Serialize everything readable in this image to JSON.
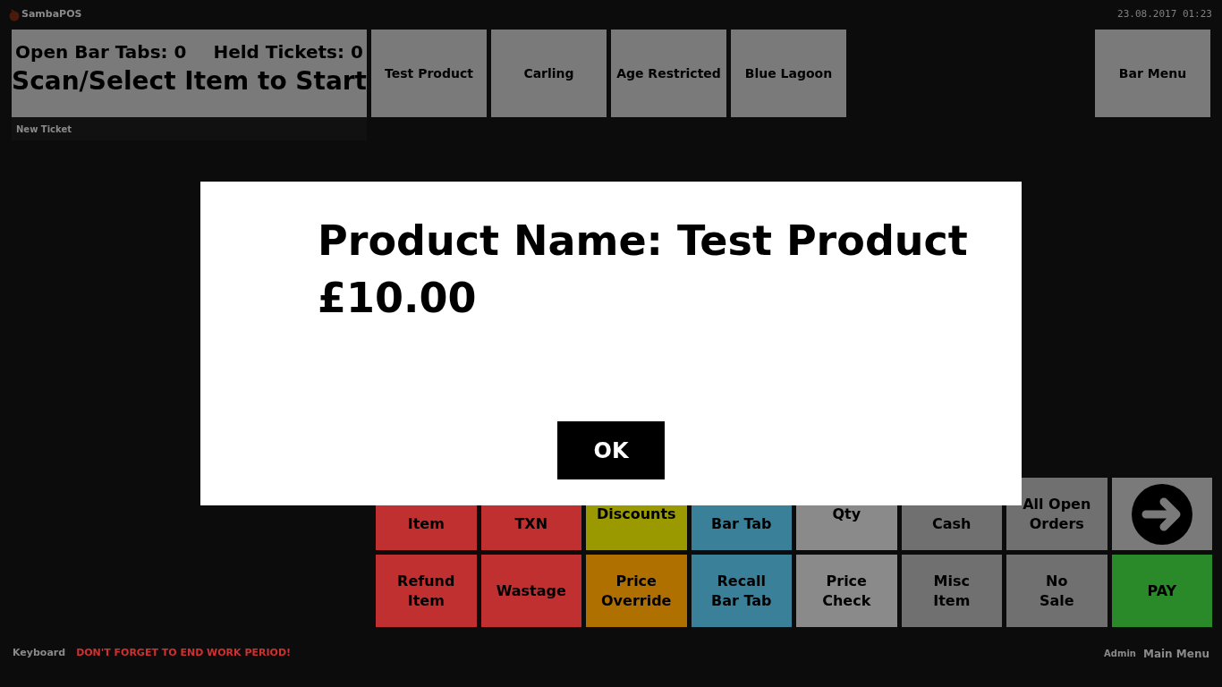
{
  "header": {
    "app_name": "SambaPOS",
    "datetime": "23.08.2017 01:23"
  },
  "ticket_panel": {
    "open_bar_tabs": "Open Bar Tabs: 0",
    "held_tickets": "Held Tickets: 0",
    "prompt": "Scan/Select Item to Start",
    "new_ticket": "New Ticket"
  },
  "products": [
    "Test Product",
    "Carling",
    "Age Restricted",
    "Blue Lagoon"
  ],
  "menu_button": "Bar Menu",
  "actions": [
    {
      "kind": "covered",
      "label": "Item",
      "color": "#c03030"
    },
    {
      "kind": "covered",
      "label": "TXN",
      "color": "#c03030"
    },
    {
      "kind": "text",
      "label": "Discounts",
      "color": "#9a9a00"
    },
    {
      "kind": "covered",
      "label": "Bar Tab",
      "color": "#3a8098"
    },
    {
      "kind": "text",
      "label": "Qty",
      "color": "#8a8a8a"
    },
    {
      "kind": "covered",
      "label": "Cash",
      "color": "#707070"
    },
    {
      "kind": "text",
      "label": "All Open\nOrders",
      "color": "#707070"
    },
    {
      "kind": "arrow",
      "color": "#7a7a7a"
    },
    {
      "kind": "text",
      "label": "Refund\nItem",
      "color": "#c03030"
    },
    {
      "kind": "text",
      "label": "Wastage",
      "color": "#c03030"
    },
    {
      "kind": "text",
      "label": "Price\nOverride",
      "color": "#b07000"
    },
    {
      "kind": "text",
      "label": "Recall\nBar Tab",
      "color": "#3a8098"
    },
    {
      "kind": "text",
      "label": "Price\nCheck",
      "color": "#8a8a8a"
    },
    {
      "kind": "text",
      "label": "Misc\nItem",
      "color": "#707070"
    },
    {
      "kind": "text",
      "label": "No\nSale",
      "color": "#707070"
    },
    {
      "kind": "text",
      "label": "PAY",
      "color": "#2a8a2a"
    }
  ],
  "footer": {
    "keyboard": "Keyboard",
    "warning": "DON'T FORGET TO END WORK PERIOD!",
    "user": "Admin",
    "main_menu": "Main Menu"
  },
  "dialog": {
    "lines": [
      "Product Name: Test Product",
      "£10.00"
    ],
    "button": "OK"
  }
}
